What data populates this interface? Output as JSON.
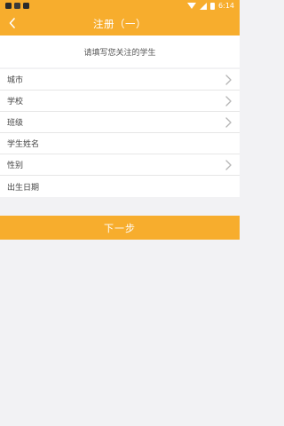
{
  "status_bar": {
    "time": "6:14"
  },
  "header": {
    "title": "注册（一）"
  },
  "subtitle": "请填写您关注的学生",
  "form": {
    "rows": [
      {
        "label": "城市",
        "has_chevron": true
      },
      {
        "label": "学校",
        "has_chevron": true
      },
      {
        "label": "班级",
        "has_chevron": true
      },
      {
        "label": "学生姓名",
        "has_chevron": false
      },
      {
        "label": "性别",
        "has_chevron": true
      },
      {
        "label": "出生日期",
        "has_chevron": false
      }
    ]
  },
  "next_button": {
    "label": "下一步"
  },
  "colors": {
    "accent": "#f7ad2d",
    "background": "#f2f2f4"
  },
  "icons": {
    "back": "chevron-left-icon",
    "chevron": "chevron-right-icon"
  }
}
